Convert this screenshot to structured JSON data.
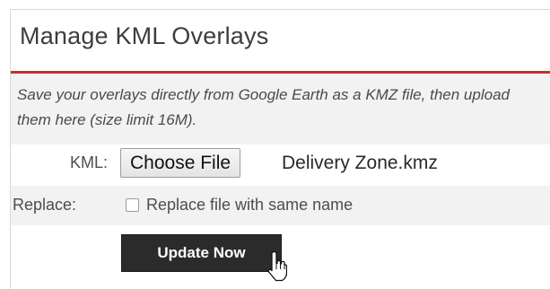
{
  "panel": {
    "title": "Manage KML Overlays",
    "accent_color": "#d32a2a",
    "intro": "Save your overlays directly from Google Earth as a KMZ file, then upload them here (size limit 16M)."
  },
  "form": {
    "kml": {
      "label": "KML:",
      "button_label": "Choose File",
      "file_name": "Delivery Zone.kmz"
    },
    "replace": {
      "label": "Replace:",
      "checkbox_label": "Replace file with same name",
      "checked": false
    },
    "submit": {
      "label": "Update Now"
    }
  },
  "cursor": {
    "icon": "pointer-cursor-icon"
  }
}
